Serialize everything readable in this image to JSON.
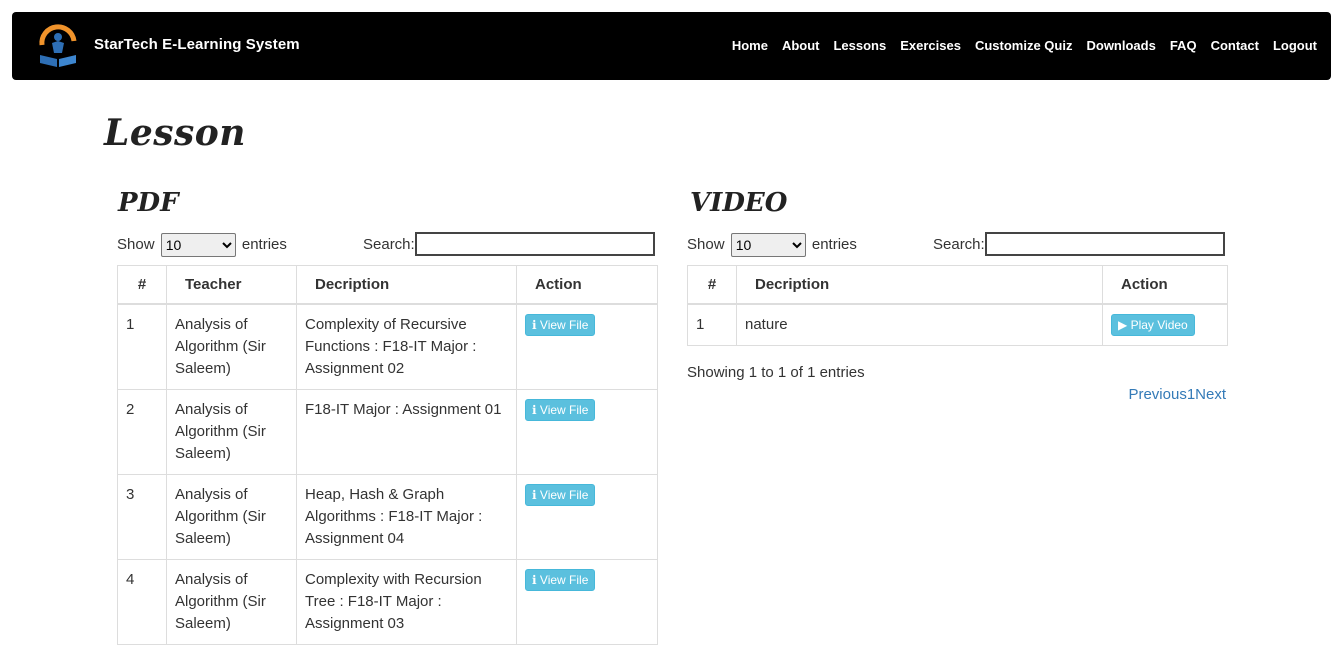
{
  "brand": "StarTech E-Learning System",
  "nav": [
    "Home",
    "About",
    "Lessons",
    "Exercises",
    "Customize Quiz",
    "Downloads",
    "FAQ",
    "Contact",
    "Logout"
  ],
  "page_title": "Lesson",
  "pdf": {
    "title": "PDF",
    "show_label": "Show",
    "entries_label": "entries",
    "page_size": "10",
    "search_label": "Search:",
    "search_value": "",
    "columns": [
      "#",
      "Teacher",
      "Decription",
      "Action"
    ],
    "rows": [
      {
        "num": "1",
        "teacher": "Analysis of Algorithm (Sir Saleem)",
        "description": "Complexity of Recursive Functions : F18-IT Major : Assignment 02",
        "action": "View File"
      },
      {
        "num": "2",
        "teacher": "Analysis of Algorithm (Sir Saleem)",
        "description": "F18-IT Major : Assignment 01",
        "action": "View File"
      },
      {
        "num": "3",
        "teacher": "Analysis of Algorithm (Sir Saleem)",
        "description": "Heap, Hash & Graph Algorithms : F18-IT Major : Assignment 04",
        "action": "View File"
      },
      {
        "num": "4",
        "teacher": "Analysis of Algorithm (Sir Saleem)",
        "description": "Complexity with Recursion Tree : F18-IT Major : Assignment 03",
        "action": "View File"
      }
    ]
  },
  "video": {
    "title": "VIDEO",
    "show_label": "Show",
    "entries_label": "entries",
    "page_size": "10",
    "search_label": "Search:",
    "search_value": "",
    "columns": [
      "#",
      "Decription",
      "Action"
    ],
    "rows": [
      {
        "num": "1",
        "description": "nature",
        "action": "Play Video"
      }
    ],
    "info": "Showing 1 to 1 of 1 entries",
    "pager": {
      "previous": "Previous",
      "page": "1",
      "next": "Next"
    }
  },
  "colors": {
    "navbar": "#000000",
    "button": "#5bc0de",
    "link": "#337ab7",
    "logo_orange": "#f0932b",
    "logo_blue": "#2e6fb5"
  },
  "icons": {
    "view": "info-icon",
    "play": "play-icon"
  }
}
